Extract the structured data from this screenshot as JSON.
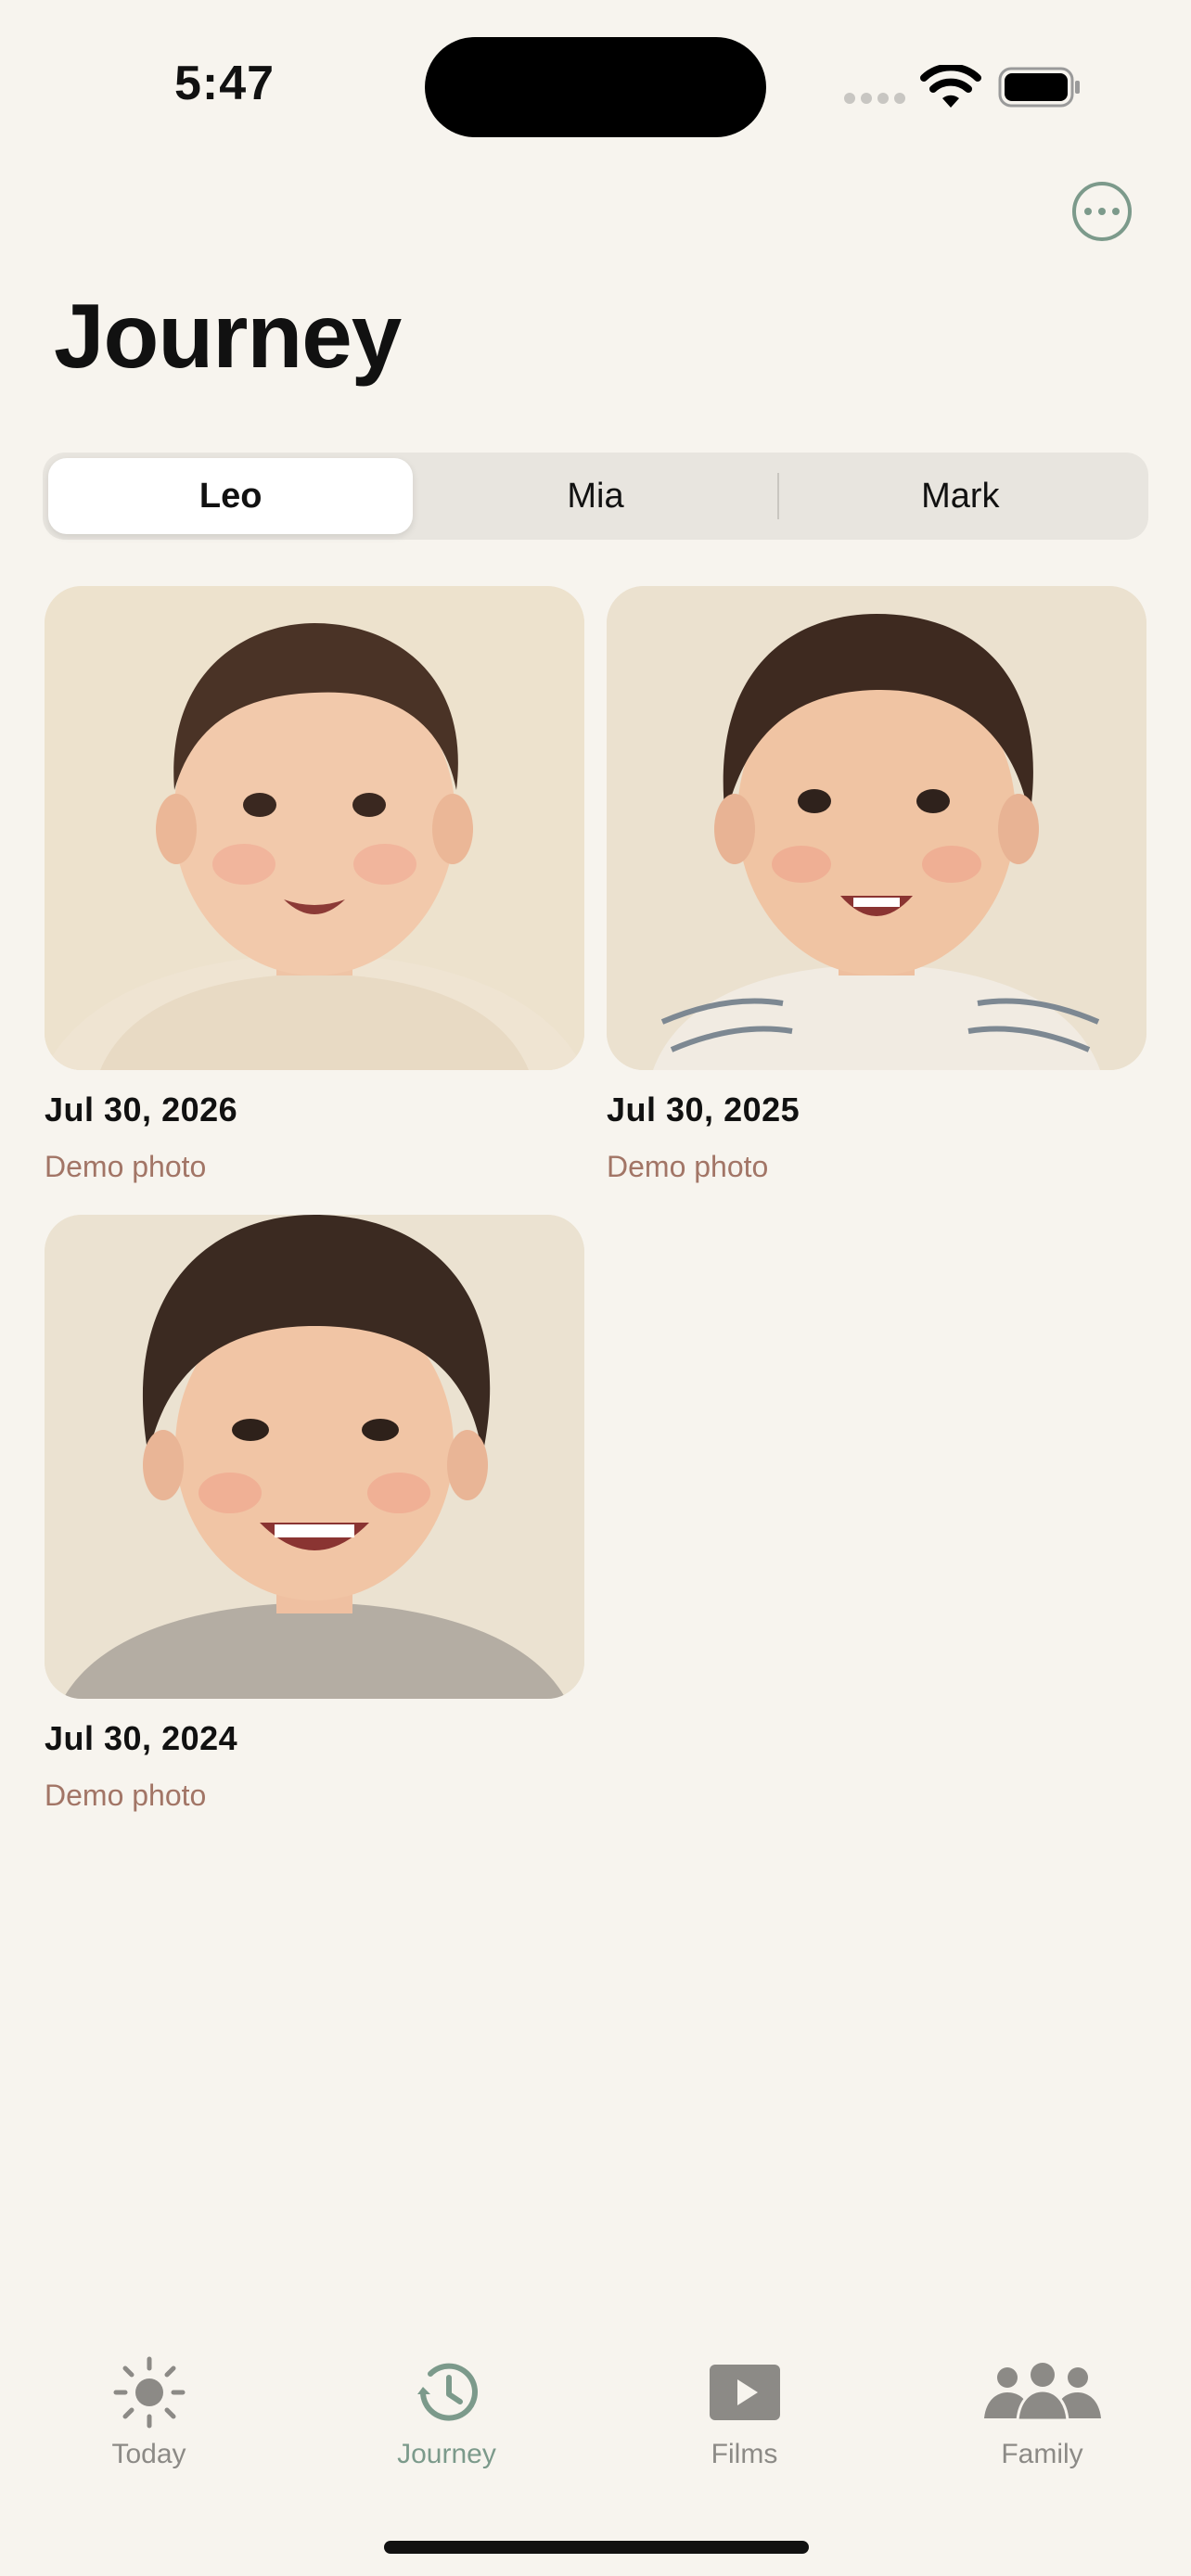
{
  "status_bar": {
    "time": "5:47"
  },
  "header": {
    "title": "Journey",
    "more_icon": "ellipsis-circle-icon"
  },
  "segments": [
    {
      "label": "Leo",
      "selected": true
    },
    {
      "label": "Mia",
      "selected": false
    },
    {
      "label": "Mark",
      "selected": false
    }
  ],
  "photos": [
    {
      "date": "Jul 30, 2026",
      "caption": "Demo photo"
    },
    {
      "date": "Jul 30, 2025",
      "caption": "Demo photo"
    },
    {
      "date": "Jul 30, 2024",
      "caption": "Demo photo"
    }
  ],
  "tabs": [
    {
      "label": "Today",
      "icon": "sun-icon",
      "active": false
    },
    {
      "label": "Journey",
      "icon": "clock-history-icon",
      "active": true
    },
    {
      "label": "Films",
      "icon": "play-rectangle-icon",
      "active": false
    },
    {
      "label": "Family",
      "icon": "people-icon",
      "active": false
    }
  ],
  "colors": {
    "background": "#f7f4ee",
    "accent": "#7c9a8b",
    "caption": "#a27566",
    "inactive_tab": "#8c8a86"
  }
}
